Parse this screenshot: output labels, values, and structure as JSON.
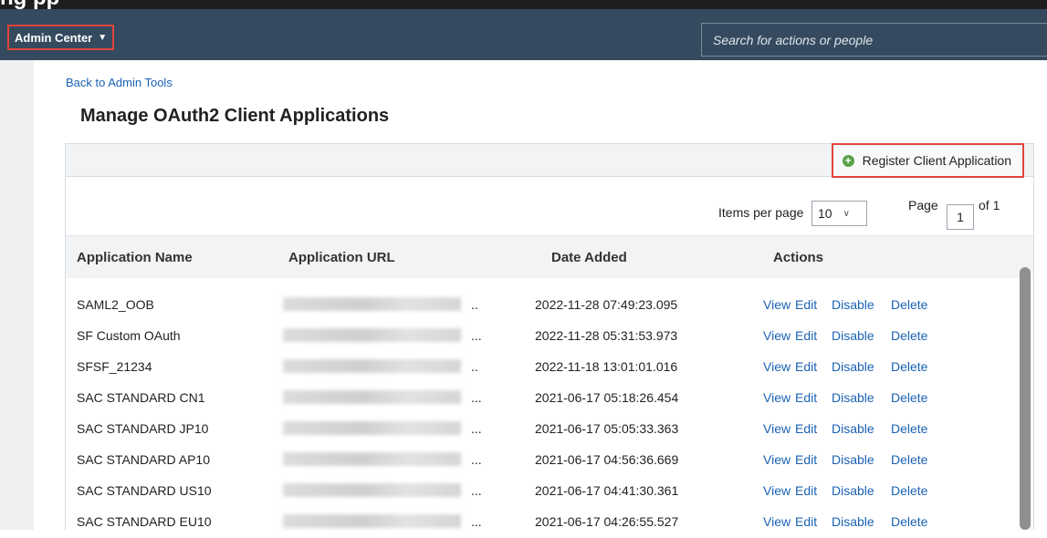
{
  "header": {
    "admin_center_label": "Admin Center",
    "search_placeholder": "Search for actions or people"
  },
  "back_link": "Back to Admin Tools",
  "page_title": "Manage OAuth2 Client Applications",
  "toolbar": {
    "register_label": "Register Client Application"
  },
  "pagination": {
    "items_per_page_label": "Items per page",
    "items_per_page_value": "10",
    "page_label": "Page",
    "page_value": "1",
    "of_label": "of 1"
  },
  "table": {
    "columns": [
      "Application Name",
      "Application URL",
      "Date Added",
      "Actions"
    ],
    "action_labels": [
      "View",
      "Edit",
      "Disable",
      "Delete"
    ],
    "url_truncation": "..",
    "rows": [
      {
        "name": "SAML2_OOB",
        "url_suffix": "..",
        "date": "2022-11-28 07:49:23.095"
      },
      {
        "name": "SF Custom OAuth",
        "url_suffix": "...",
        "date": "2022-11-28 05:31:53.973"
      },
      {
        "name": "SFSF_21234",
        "url_suffix": "..",
        "date": "2022-11-18 13:01:01.016"
      },
      {
        "name": "SAC STANDARD CN1",
        "url_suffix": "...",
        "date": "2021-06-17 05:18:26.454"
      },
      {
        "name": "SAC STANDARD JP10",
        "url_suffix": "...",
        "date": "2021-06-17 05:05:33.363"
      },
      {
        "name": "SAC STANDARD AP10",
        "url_suffix": "...",
        "date": "2021-06-17 04:56:36.669"
      },
      {
        "name": "SAC STANDARD US10",
        "url_suffix": "...",
        "date": "2021-06-17 04:41:30.361"
      },
      {
        "name": "SAC STANDARD EU10",
        "url_suffix": "...",
        "date": "2021-06-17 04:26:55.527"
      }
    ]
  },
  "colors": {
    "header_bg": "#354a5f",
    "link": "#1a62b4",
    "highlight_border": "#e0453b",
    "add_icon": "#5aa248"
  }
}
